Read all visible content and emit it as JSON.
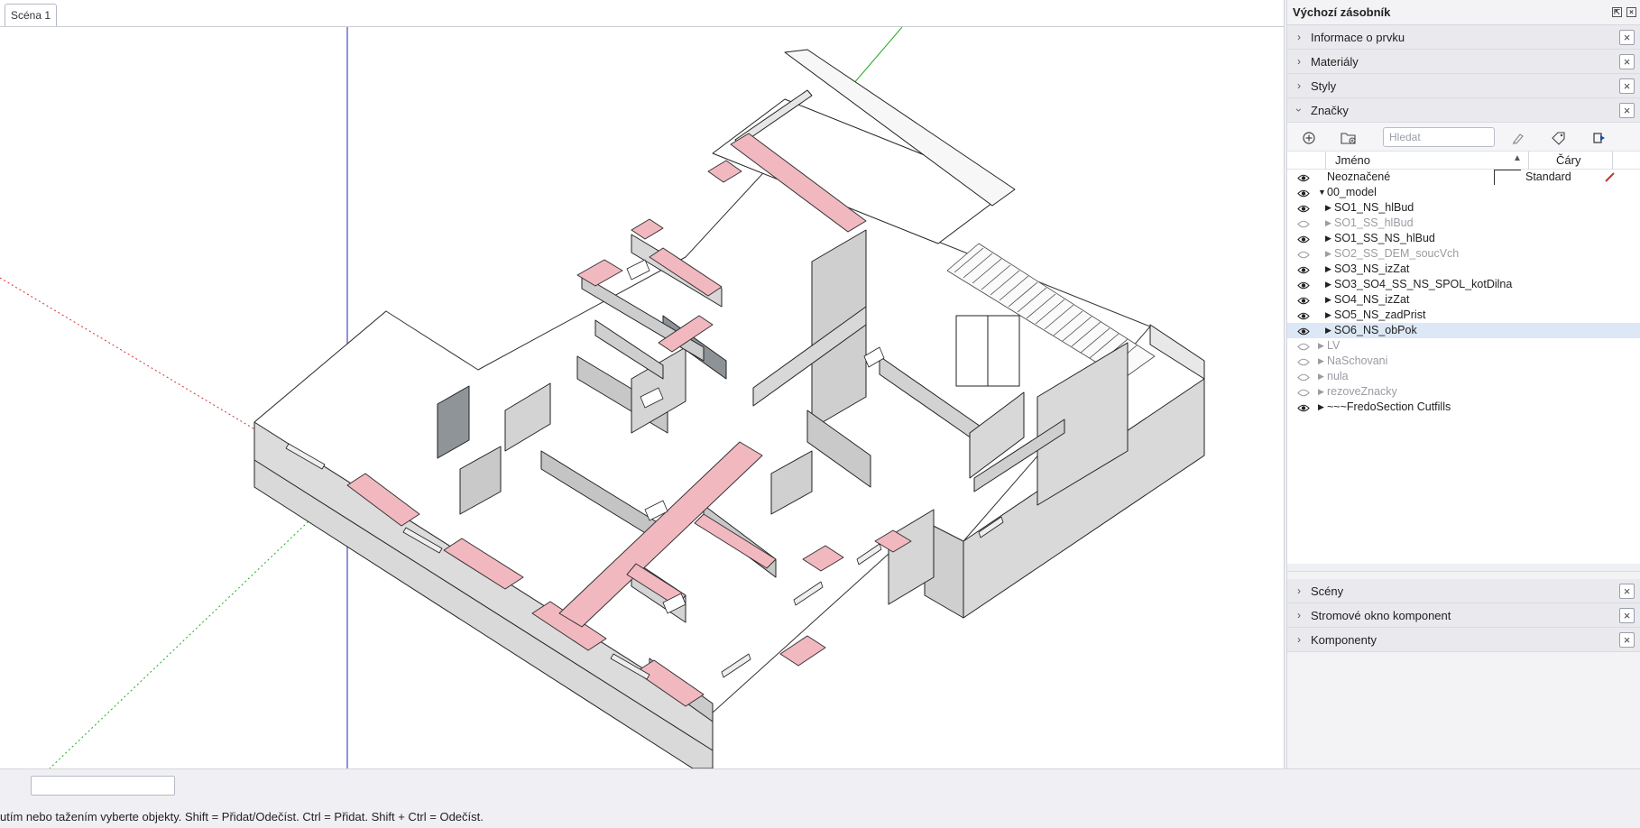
{
  "viewport": {
    "scene_tab": "Scéna 1"
  },
  "statusbar": {
    "text": "utím nebo tažením vyberte objekty. Shift = Přidat/Odečíst. Ctrl = Přidat. Shift + Ctrl = Odečíst.",
    "measurements_value": ""
  },
  "tray": {
    "title": "Výchozí zásobník",
    "panels_top": [
      {
        "label": "Informace o prvku",
        "expanded": false
      },
      {
        "label": "Materiály",
        "expanded": false
      },
      {
        "label": "Styly",
        "expanded": false
      },
      {
        "label": "Značky",
        "expanded": true
      }
    ],
    "tags": {
      "search_placeholder": "Hledat",
      "col_name": "Jméno",
      "col_lines": "Čáry",
      "rows": [
        {
          "name": "Neoznačené",
          "visible": true,
          "level": 0,
          "arrow": "",
          "line_style": "Standard"
        },
        {
          "name": "00_model",
          "visible": true,
          "level": 0,
          "arrow": "▼"
        },
        {
          "name": "SO1_NS_hlBud",
          "visible": true,
          "level": 1,
          "arrow": "▶"
        },
        {
          "name": "SO1_SS_hlBud",
          "visible": false,
          "level": 1,
          "arrow": "▶"
        },
        {
          "name": "SO1_SS_NS_hlBud",
          "visible": true,
          "level": 1,
          "arrow": "▶"
        },
        {
          "name": "SO2_SS_DEM_soucVch",
          "visible": false,
          "level": 1,
          "arrow": "▶"
        },
        {
          "name": "SO3_NS_izZat",
          "visible": true,
          "level": 1,
          "arrow": "▶"
        },
        {
          "name": "SO3_SO4_SS_NS_SPOL_kotDilna",
          "visible": true,
          "level": 1,
          "arrow": "▶"
        },
        {
          "name": "SO4_NS_izZat",
          "visible": true,
          "level": 1,
          "arrow": "▶"
        },
        {
          "name": "SO5_NS_zadPrist",
          "visible": true,
          "level": 1,
          "arrow": "▶"
        },
        {
          "name": "SO6_NS_obPok",
          "visible": true,
          "level": 1,
          "arrow": "▶",
          "selected": true
        },
        {
          "name": "LV",
          "visible": false,
          "level": 0,
          "arrow": "▶"
        },
        {
          "name": "NaSchovani",
          "visible": false,
          "level": 0,
          "arrow": "▶"
        },
        {
          "name": "nula",
          "visible": false,
          "level": 0,
          "arrow": "▶"
        },
        {
          "name": "rezoveZnacky",
          "visible": false,
          "level": 0,
          "arrow": "▶"
        },
        {
          "name": "~~~FredoSection Cutfills",
          "visible": true,
          "level": 0,
          "arrow": "▶"
        }
      ]
    },
    "panels_bottom": [
      {
        "label": "Scény"
      },
      {
        "label": "Stromové okno komponent"
      },
      {
        "label": "Komponenty"
      }
    ]
  },
  "colors": {
    "wall_fill": "#d9d9d9",
    "wall_top": "#f2f2f2",
    "cut_pink": "#f2b8c0",
    "axis_red": "#d23232",
    "axis_green": "#22aa22",
    "axis_blue": "#2424b4",
    "selected_row": "#dde8f6"
  },
  "icons": [
    "add-tag-icon",
    "add-folder-icon",
    "paint-icon",
    "color-by-tag-icon",
    "details-icon",
    "eye-icon",
    "pencil-icon",
    "chevron-right-icon",
    "chevron-down-icon",
    "close-icon"
  ]
}
